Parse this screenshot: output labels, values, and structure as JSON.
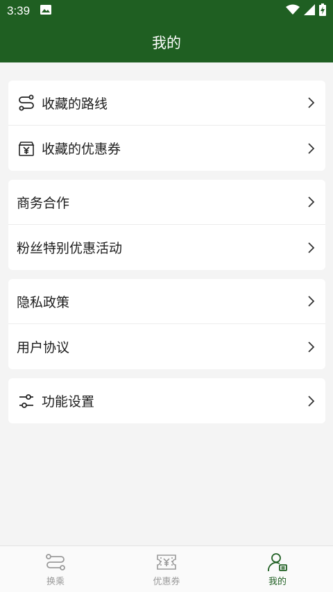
{
  "status_bar": {
    "time": "3:39",
    "icons": [
      "image-icon",
      "wifi-icon",
      "signal-icon",
      "battery-charging-icon"
    ]
  },
  "header": {
    "title": "我的"
  },
  "groups": [
    {
      "items": [
        {
          "label": "收藏的路线",
          "icon": "route-icon"
        },
        {
          "label": "收藏的优惠券",
          "icon": "coupon-bag-icon"
        }
      ]
    },
    {
      "items": [
        {
          "label": "商务合作"
        },
        {
          "label": "粉丝特别优惠活动"
        }
      ]
    },
    {
      "items": [
        {
          "label": "隐私政策"
        },
        {
          "label": "用户协议"
        }
      ]
    },
    {
      "items": [
        {
          "label": "功能设置",
          "icon": "settings-sliders-icon"
        }
      ]
    }
  ],
  "bottom_nav": {
    "tabs": [
      {
        "label": "换乘",
        "icon": "transfer-icon",
        "active": false
      },
      {
        "label": "优惠券",
        "icon": "coupon-icon",
        "active": false
      },
      {
        "label": "我的",
        "icon": "profile-icon",
        "active": true
      }
    ]
  },
  "colors": {
    "primary": "#1f5f22",
    "background": "#f4f4f4",
    "inactive": "#9a9a9a"
  }
}
